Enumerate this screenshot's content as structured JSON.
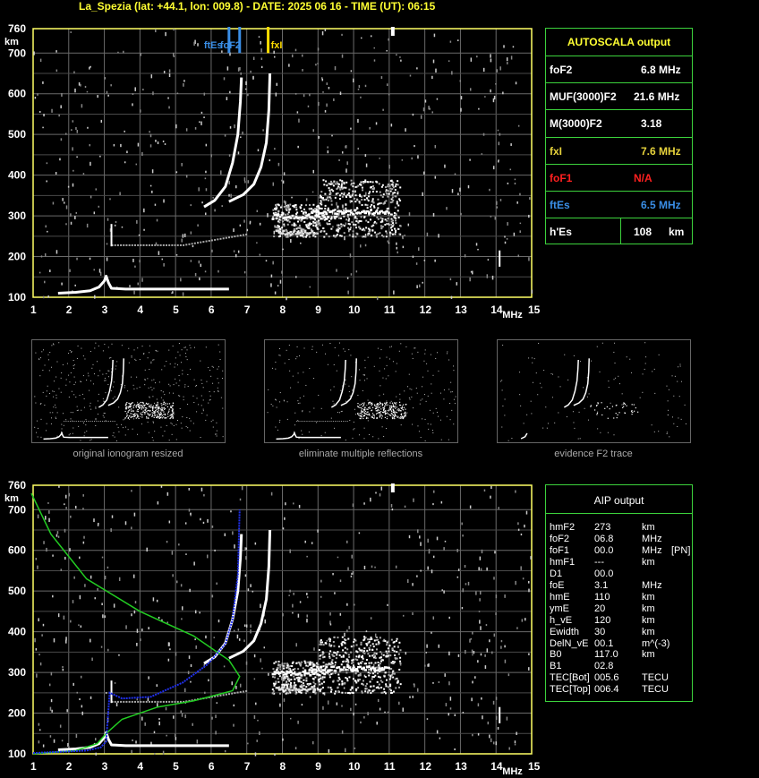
{
  "header": {
    "title": "La_Spezia (lat: +44.1, lon: 009.8) - DATE: 2025 06 16 - TIME (UT): 06:15"
  },
  "plot": {
    "y_unit": "km",
    "x_unit": "MHz",
    "y_ticks": [
      "760",
      "700",
      "600",
      "500",
      "400",
      "300",
      "200",
      "100"
    ],
    "x_ticks": [
      "1",
      "2",
      "3",
      "4",
      "5",
      "6",
      "7",
      "8",
      "9",
      "10",
      "11",
      "12",
      "13",
      "14",
      "15"
    ],
    "markers": {
      "ftEs": {
        "label": "ftEs",
        "freq": 6.5,
        "color": "#3a8ee6"
      },
      "foF2": {
        "label": "foF2",
        "freq": 6.8,
        "color": "#3a8ee6"
      },
      "fxI": {
        "label": "fxI",
        "freq": 7.6,
        "color": "#ffdd00"
      }
    }
  },
  "autoscala": {
    "title": "AUTOSCALA output",
    "rows": [
      {
        "name": "foF2",
        "value": "6.8 MHz",
        "color": "#ffffff"
      },
      {
        "name": "MUF(3000)F2",
        "value": "21.6 MHz",
        "color": "#ffffff"
      },
      {
        "name": "M(3000)F2",
        "value": "3.18",
        "color": "#ffffff"
      },
      {
        "name": "fxI",
        "value": "7.6 MHz",
        "color": "#e6d23c"
      },
      {
        "name": "foF1",
        "value": "N/A",
        "color": "#ff2020"
      },
      {
        "name": "ftEs",
        "value": "6.5 MHz",
        "color": "#3a8ee6"
      },
      {
        "name": "h'Es",
        "value": "108",
        "unit": "km",
        "color": "#ffffff"
      }
    ]
  },
  "thumbnails": [
    {
      "caption": "original ionogram resized"
    },
    {
      "caption": "eliminate multiple reflections"
    },
    {
      "caption": "evidence F2 trace"
    }
  ],
  "aip": {
    "title": "AIP output",
    "rows": [
      {
        "name": "hmF2",
        "value": "273",
        "unit": "km",
        "extra": ""
      },
      {
        "name": "foF2",
        "value": "06.8",
        "unit": "MHz",
        "extra": ""
      },
      {
        "name": "foF1",
        "value": "00.0",
        "unit": "MHz",
        "extra": "[PN]"
      },
      {
        "name": "hmF1",
        "value": "---",
        "unit": "km",
        "extra": ""
      },
      {
        "name": "D1",
        "value": "00.0",
        "unit": "",
        "extra": ""
      },
      {
        "name": "foE",
        "value": "3.1",
        "unit": "MHz",
        "extra": ""
      },
      {
        "name": "hmE",
        "value": "110",
        "unit": "km",
        "extra": ""
      },
      {
        "name": "ymE",
        "value": "20",
        "unit": "km",
        "extra": ""
      },
      {
        "name": "h_vE",
        "value": "120",
        "unit": "km",
        "extra": ""
      },
      {
        "name": "Ewidth",
        "value": "30",
        "unit": "km",
        "extra": ""
      },
      {
        "name": "DelN_vE",
        "value": "00.1",
        "unit": "m^(-3)",
        "extra": ""
      },
      {
        "name": "B0",
        "value": "117.0",
        "unit": "km",
        "extra": ""
      },
      {
        "name": "B1",
        "value": "02.8",
        "unit": "",
        "extra": ""
      },
      {
        "name": "TEC[Bot]",
        "value": "005.6",
        "unit": "TECU",
        "extra": ""
      },
      {
        "name": "TEC[Top]",
        "value": "006.4",
        "unit": "TECU",
        "extra": ""
      }
    ]
  },
  "chart_data": [
    {
      "type": "scatter",
      "name_ref": "top ionogram",
      "xlim": [
        1,
        15
      ],
      "ylim": [
        100,
        760
      ],
      "traces": {
        "E": [
          [
            1.7,
            110
          ],
          [
            2.2,
            112
          ],
          [
            2.6,
            116
          ],
          [
            2.85,
            125
          ],
          [
            3.0,
            140
          ],
          [
            3.05,
            152
          ],
          [
            3.12,
            135
          ],
          [
            3.2,
            122
          ],
          [
            3.6,
            120
          ],
          [
            4.5,
            120
          ],
          [
            5.5,
            120
          ],
          [
            6.5,
            120
          ]
        ],
        "Es_faint": [
          [
            3.2,
            230
          ],
          [
            4.5,
            228
          ],
          [
            5.6,
            235
          ],
          [
            6.5,
            250
          ],
          [
            7.0,
            265
          ]
        ],
        "O": [
          [
            5.8,
            322
          ],
          [
            6.1,
            338
          ],
          [
            6.4,
            372
          ],
          [
            6.6,
            430
          ],
          [
            6.75,
            500
          ],
          [
            6.82,
            580
          ],
          [
            6.85,
            640
          ]
        ],
        "X": [
          [
            6.5,
            335
          ],
          [
            6.9,
            352
          ],
          [
            7.2,
            378
          ],
          [
            7.4,
            420
          ],
          [
            7.55,
            480
          ],
          [
            7.62,
            560
          ],
          [
            7.65,
            650
          ]
        ],
        "multiple": [
          [
            7.8,
            255
          ],
          [
            8.5,
            265
          ],
          [
            9.5,
            300
          ],
          [
            10.5,
            310
          ],
          [
            11,
            315
          ]
        ]
      }
    },
    {
      "type": "line",
      "name_ref": "bottom ionogram with profile",
      "xlim": [
        1,
        15
      ],
      "ylim": [
        100,
        760
      ],
      "series": [
        {
          "color": "#22cc22",
          "points": [
            [
              0.95,
              740
            ],
            [
              1.5,
              640
            ],
            [
              2.5,
              530
            ],
            [
              4.0,
              450
            ],
            [
              5.5,
              390
            ],
            [
              6.5,
              330
            ],
            [
              6.8,
              290
            ],
            [
              6.6,
              255
            ],
            [
              5.5,
              230
            ],
            [
              4.5,
              215
            ],
            [
              3.5,
              185
            ],
            [
              3.05,
              150
            ],
            [
              2.8,
              125
            ],
            [
              2.2,
              108
            ],
            [
              1.0,
              100
            ]
          ]
        },
        {
          "color": "#2030ee",
          "points": [
            [
              1.0,
              102
            ],
            [
              2.5,
              108
            ],
            [
              2.9,
              116
            ],
            [
              3.05,
              130
            ],
            [
              3.15,
              250
            ],
            [
              3.5,
              236
            ],
            [
              4.3,
              240
            ],
            [
              5.2,
              275
            ],
            [
              5.9,
              320
            ],
            [
              6.4,
              370
            ],
            [
              6.6,
              430
            ],
            [
              6.75,
              540
            ],
            [
              6.8,
              700
            ]
          ]
        }
      ]
    }
  ]
}
